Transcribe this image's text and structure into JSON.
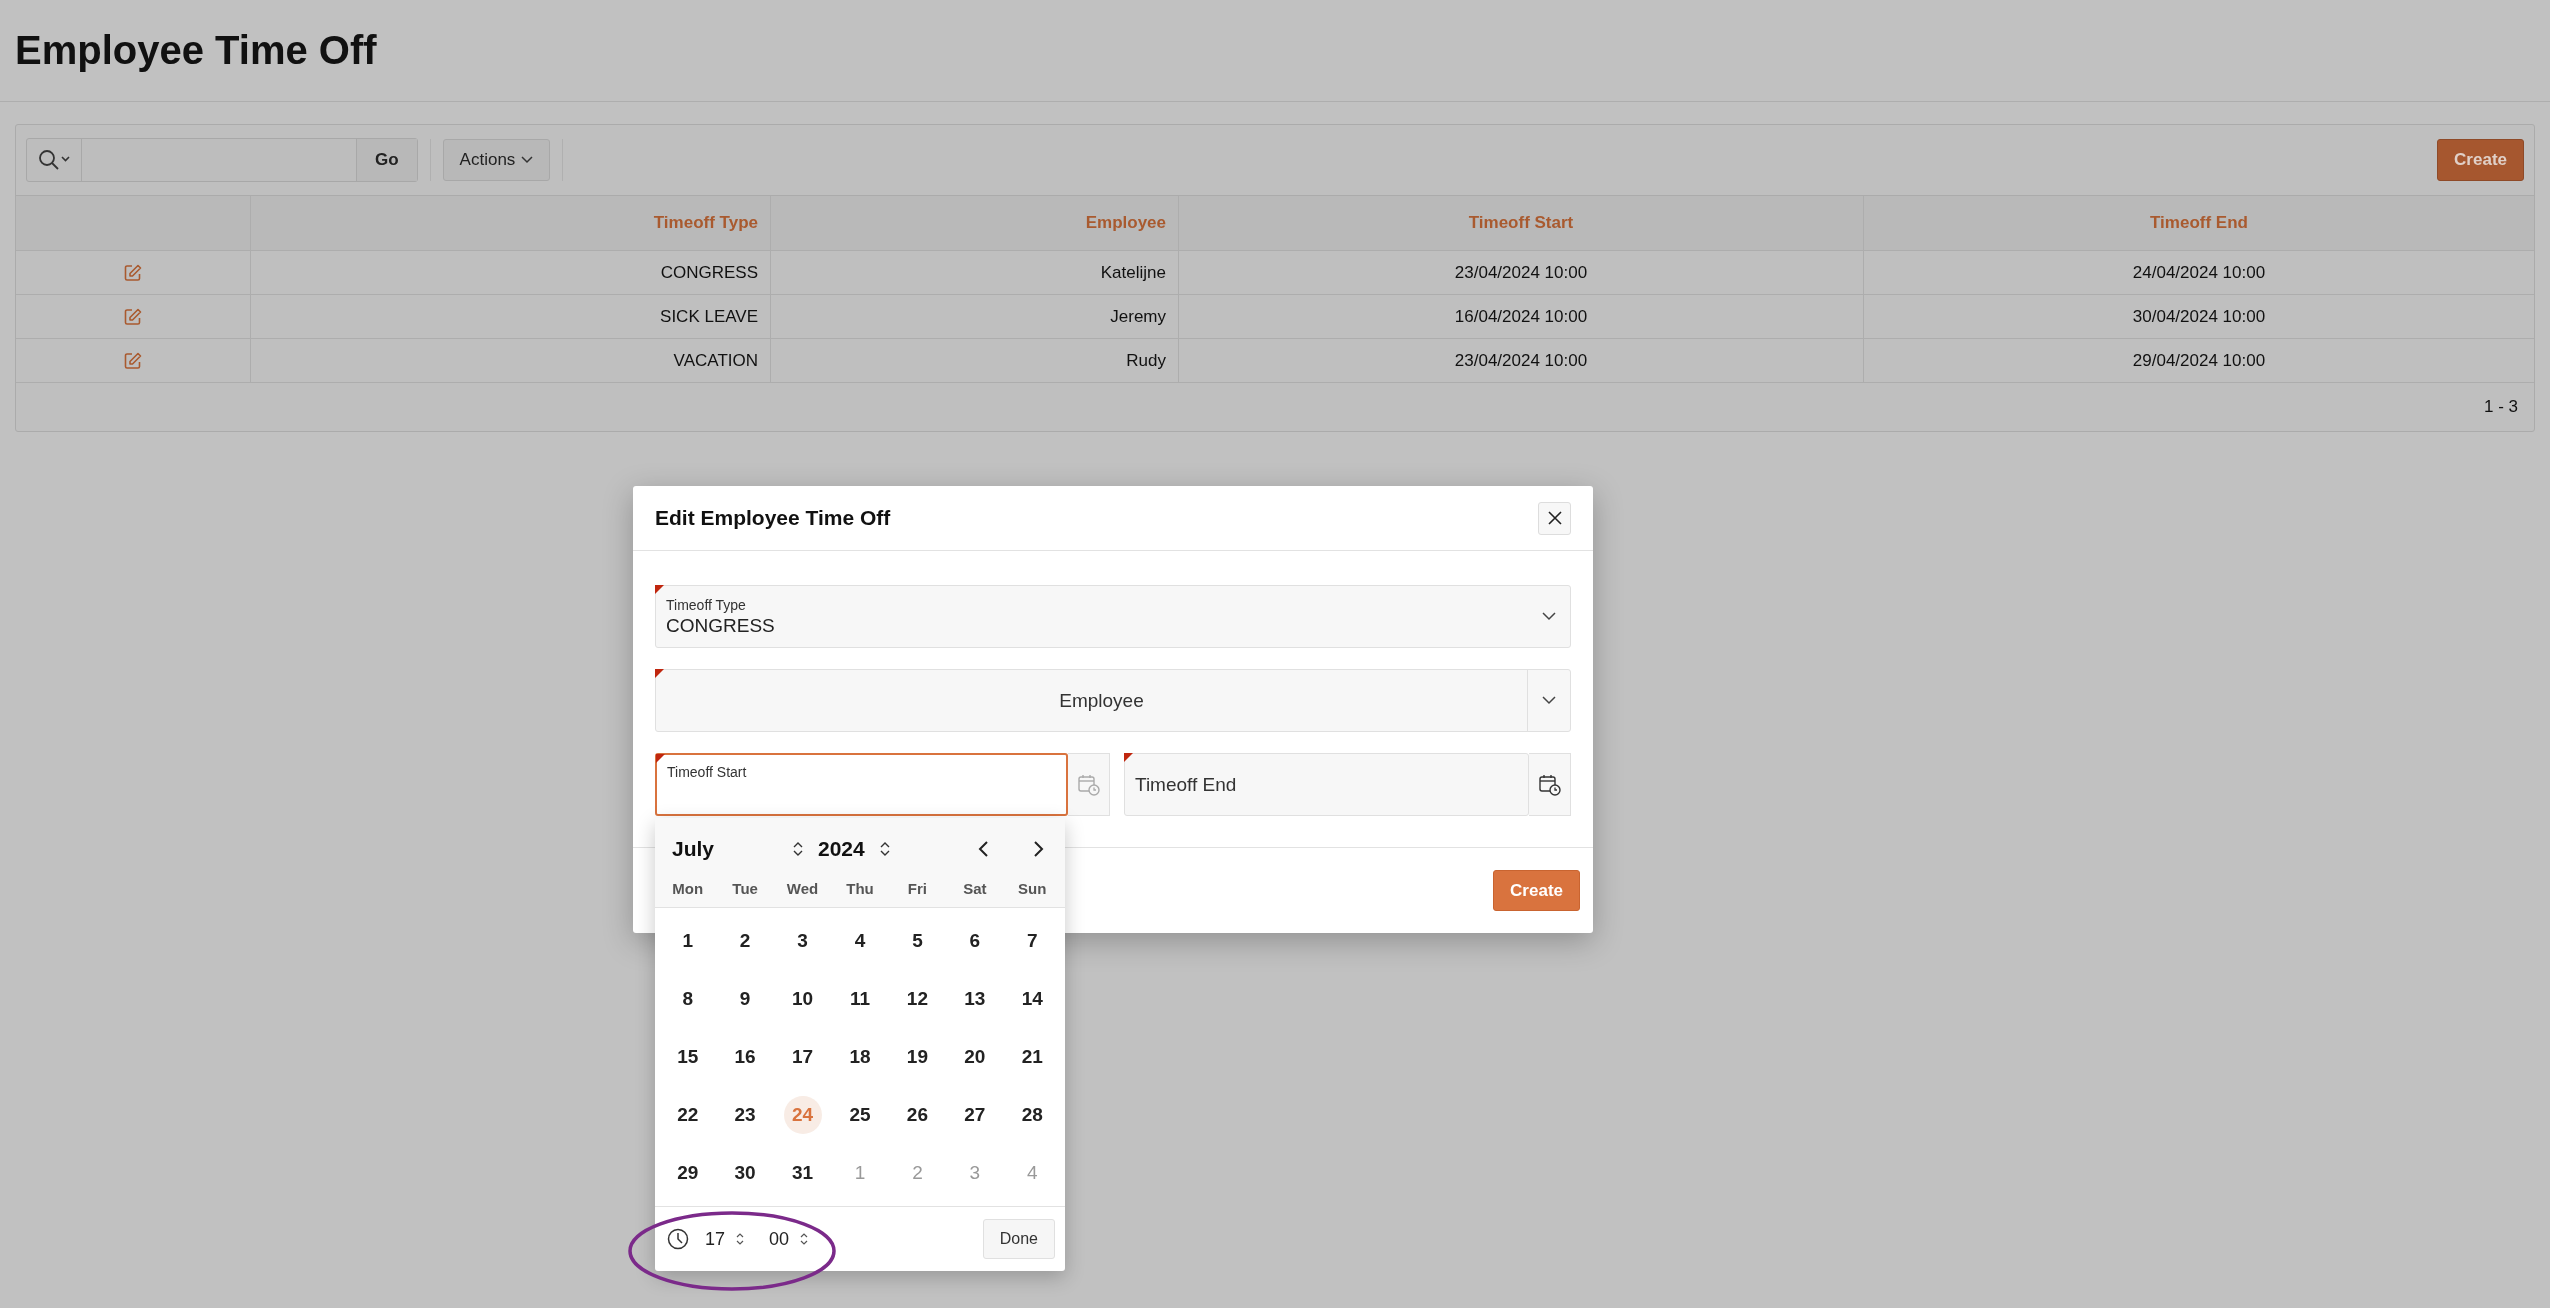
{
  "page": {
    "title": "Employee Time Off"
  },
  "toolbar": {
    "go_button": "Go",
    "actions_button": "Actions",
    "create_button": "Create"
  },
  "table": {
    "columns": [
      "Timeoff Type",
      "Employee",
      "Timeoff Start",
      "Timeoff End"
    ],
    "rows": [
      {
        "cells": [
          "CONGRESS",
          "Katelijne",
          "23/04/2024 10:00",
          "24/04/2024 10:00"
        ]
      },
      {
        "cells": [
          "SICK LEAVE",
          "Jeremy",
          "16/04/2024 10:00",
          "30/04/2024 10:00"
        ]
      },
      {
        "cells": [
          "VACATION",
          "Rudy",
          "23/04/2024 10:00",
          "29/04/2024 10:00"
        ]
      }
    ],
    "pagination": "1 - 3"
  },
  "dialog": {
    "title": "Edit Employee Time Off",
    "fields": [
      {
        "kind": "select",
        "label": "Timeoff Type",
        "value": "CONGRESS",
        "required": true,
        "focused": false
      },
      {
        "kind": "lov",
        "label": "Employee",
        "required": true,
        "focused": false
      },
      {
        "kind": "date",
        "label": "Timeoff Start",
        "required": true,
        "focused": true
      },
      {
        "kind": "date",
        "label": "Timeoff End",
        "required": true,
        "focused": false
      }
    ],
    "create_button": "Create"
  },
  "datepicker": {
    "month": "July",
    "year": "2024",
    "weekdays": [
      "Mon",
      "Tue",
      "Wed",
      "Thu",
      "Fri",
      "Sat",
      "Sun"
    ],
    "days": [
      {
        "label": "1",
        "outside": false,
        "selected": false
      },
      {
        "label": "2",
        "outside": false,
        "selected": false
      },
      {
        "label": "3",
        "outside": false,
        "selected": false
      },
      {
        "label": "4",
        "outside": false,
        "selected": false
      },
      {
        "label": "5",
        "outside": false,
        "selected": false
      },
      {
        "label": "6",
        "outside": false,
        "selected": false
      },
      {
        "label": "7",
        "outside": false,
        "selected": false
      },
      {
        "label": "8",
        "outside": false,
        "selected": false
      },
      {
        "label": "9",
        "outside": false,
        "selected": false
      },
      {
        "label": "10",
        "outside": false,
        "selected": false
      },
      {
        "label": "11",
        "outside": false,
        "selected": false
      },
      {
        "label": "12",
        "outside": false,
        "selected": false
      },
      {
        "label": "13",
        "outside": false,
        "selected": false
      },
      {
        "label": "14",
        "outside": false,
        "selected": false
      },
      {
        "label": "15",
        "outside": false,
        "selected": false
      },
      {
        "label": "16",
        "outside": false,
        "selected": false
      },
      {
        "label": "17",
        "outside": false,
        "selected": false
      },
      {
        "label": "18",
        "outside": false,
        "selected": false
      },
      {
        "label": "19",
        "outside": false,
        "selected": false
      },
      {
        "label": "20",
        "outside": false,
        "selected": false
      },
      {
        "label": "21",
        "outside": false,
        "selected": false
      },
      {
        "label": "22",
        "outside": false,
        "selected": false
      },
      {
        "label": "23",
        "outside": false,
        "selected": false
      },
      {
        "label": "24",
        "outside": false,
        "selected": true
      },
      {
        "label": "25",
        "outside": false,
        "selected": false
      },
      {
        "label": "26",
        "outside": false,
        "selected": false
      },
      {
        "label": "27",
        "outside": false,
        "selected": false
      },
      {
        "label": "28",
        "outside": false,
        "selected": false
      },
      {
        "label": "29",
        "outside": false,
        "selected": false
      },
      {
        "label": "30",
        "outside": false,
        "selected": false
      },
      {
        "label": "31",
        "outside": false,
        "selected": false
      },
      {
        "label": "1",
        "outside": true,
        "selected": false
      },
      {
        "label": "2",
        "outside": true,
        "selected": false
      },
      {
        "label": "3",
        "outside": true,
        "selected": false
      },
      {
        "label": "4",
        "outside": true,
        "selected": false
      }
    ],
    "hour": "17",
    "minute": "00",
    "done_button": "Done"
  }
}
